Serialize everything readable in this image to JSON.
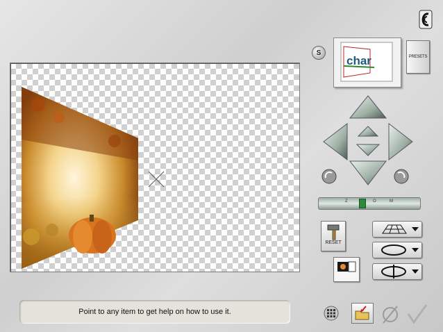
{
  "help": {
    "text": "Point to any item to get help on how to use it."
  },
  "buttons": {
    "s_label": "S",
    "preset_label": "PRESETS",
    "reset_label": "RESET"
  },
  "preview": {
    "text": "char"
  },
  "icons": {
    "logo": "corel-logo-icon",
    "grid": "grid-icon",
    "open": "open-folder-icon",
    "cancel": "cancel-icon",
    "ok": "ok-check-icon",
    "up": "arrow-up-icon",
    "down": "arrow-down-icon",
    "left": "arrow-left-icon",
    "right": "arrow-right-icon"
  },
  "slider": {
    "ticks": [
      "Z",
      "O",
      "M"
    ]
  }
}
